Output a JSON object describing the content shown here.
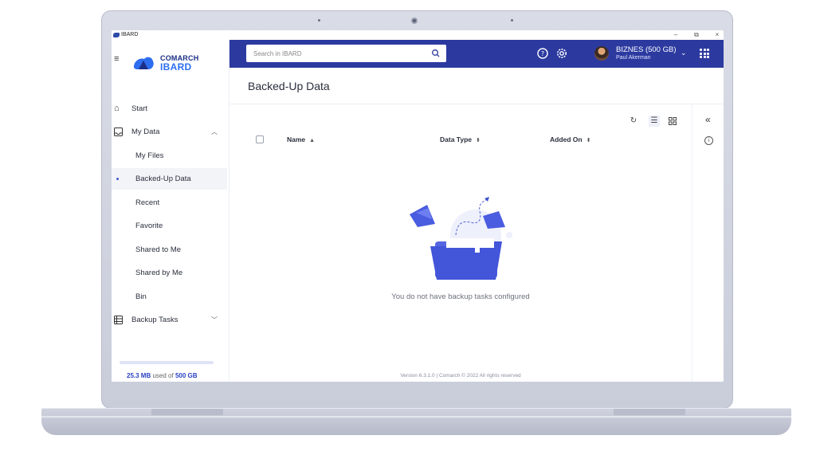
{
  "window": {
    "title": "IBARD",
    "minimize": "–",
    "maximize": "⧉",
    "close": "×"
  },
  "brand": {
    "line1": "COMARCH",
    "line2": "IBARD"
  },
  "search": {
    "placeholder": "Search in IBARD",
    "value": ""
  },
  "user": {
    "plan": "BIZNES (500 GB)",
    "name": "Paul Akerman"
  },
  "sidebar": {
    "items": [
      {
        "label": "Start",
        "icon": "home-icon"
      },
      {
        "label": "My Data",
        "icon": "inbox-icon",
        "expanded": true
      },
      {
        "label": "My Files"
      },
      {
        "label": "Backed-Up Data",
        "active": true
      },
      {
        "label": "Recent"
      },
      {
        "label": "Favorite"
      },
      {
        "label": "Shared to Me"
      },
      {
        "label": "Shared by Me"
      },
      {
        "label": "Bin"
      },
      {
        "label": "Backup Tasks",
        "icon": "tasks-icon",
        "expanded": false
      }
    ],
    "storage": {
      "used": "25.3 MB",
      "separator": "used of",
      "total": "500 GB",
      "fraction_used": 0.0001
    }
  },
  "main": {
    "title": "Backed-Up Data",
    "columns": [
      {
        "label": "Name",
        "sort": "▲"
      },
      {
        "label": "Data Type",
        "sort": "⬍"
      },
      {
        "label": "Added On",
        "sort": "⬍"
      }
    ],
    "empty_message": "You do not have backup tasks configured",
    "footer": "Version 6.3.1.0  |  Comarch © 2022 All rights reserved"
  },
  "colors": {
    "header": "#2c3aa0",
    "accent": "#3e54d0",
    "brand_dark": "#1c2f86",
    "brand_light": "#2d6df0"
  }
}
